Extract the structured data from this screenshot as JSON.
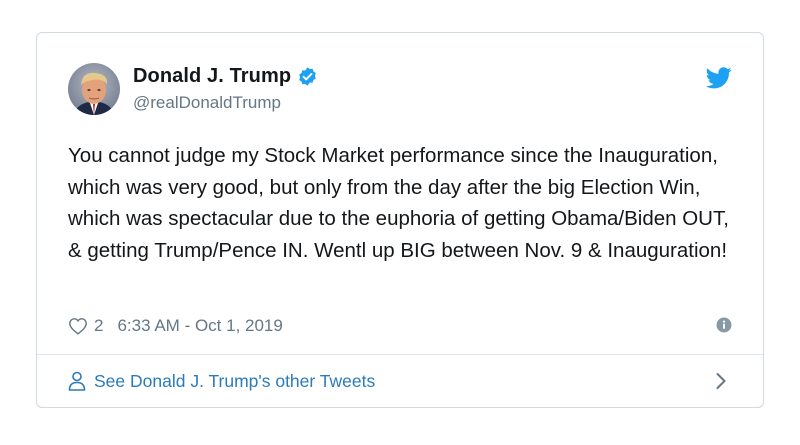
{
  "user": {
    "display_name": "Donald J. Trump",
    "handle": "@realDonaldTrump",
    "verified": true
  },
  "tweet": {
    "text": "You cannot judge my Stock Market performance since the Inauguration, which was very good, but only from the day after the big Election Win, which was spectacular due to the euphoria of getting Obama/Biden OUT, & getting Trump/Pence IN. Wentl up BIG between Nov. 9 & Inauguration!",
    "like_count": "2",
    "timestamp": "6:33 AM - Oct 1, 2019"
  },
  "footer": {
    "label": "See Donald J. Trump's other Tweets"
  },
  "icons": {
    "brand": "twitter-bird-icon",
    "verified": "verified-badge-icon",
    "like": "heart-outline-icon",
    "info": "info-icon",
    "person": "person-icon",
    "chevron": "chevron-right-icon"
  },
  "colors": {
    "accent": "#1da1f2",
    "link": "#2b7bb9",
    "text": "#14171a",
    "secondary": "#657786",
    "border": "#cfd9de"
  }
}
